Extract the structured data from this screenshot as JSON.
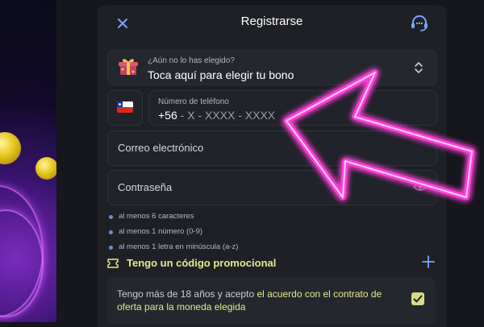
{
  "modal": {
    "title": "Registrarse"
  },
  "bonus": {
    "hint": "¿Aún no lo has elegido?",
    "label": "Toca aquí para elegir tu bono"
  },
  "phone": {
    "label": "Número de teléfono",
    "prefix": "+56",
    "mask": " - X - XXXX - XXXX"
  },
  "email": {
    "label": "Correo electrónico"
  },
  "password": {
    "label": "Contraseña"
  },
  "password_rules": [
    "al menos 6 caracteres",
    "al menos 1 número (0-9)",
    "al menos 1 letra en minúscula (a-z)"
  ],
  "promo": {
    "label": "Tengo un código promocional"
  },
  "terms": {
    "text_before": "Tengo más de 18 años y acepto ",
    "link": "el acuerdo con el contrato de oferta para la moneda elegida",
    "accepted": true
  },
  "colors": {
    "accent_blue": "#7fa4ff",
    "promo_yellow": "#e6e98e",
    "neon_arrow": "#ff3fd8"
  },
  "icons": [
    "close-icon",
    "headset-icon",
    "gift-icon",
    "chevron-updown-icon",
    "chile-flag-icon",
    "eye-icon",
    "ticket-icon",
    "plus-icon",
    "check-icon"
  ]
}
